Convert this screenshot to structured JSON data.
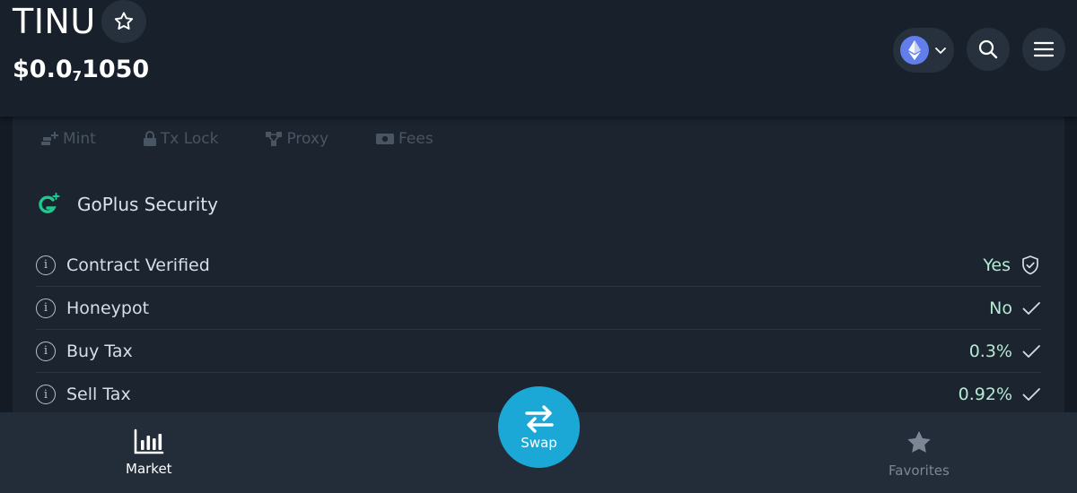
{
  "header": {
    "token_name": "TINU",
    "price_prefix": "$0.0",
    "price_zeros": "7",
    "price_suffix": "1050"
  },
  "tabs": [
    {
      "label": "Mint",
      "icon": "mint-icon"
    },
    {
      "label": "Tx Lock",
      "icon": "lock-icon"
    },
    {
      "label": "Proxy",
      "icon": "proxy-icon"
    },
    {
      "label": "Fees",
      "icon": "fees-icon"
    }
  ],
  "security": {
    "title": "GoPlus Security",
    "rows": [
      {
        "label": "Contract Verified",
        "value": "Yes",
        "icon": "shield-check-icon"
      },
      {
        "label": "Honeypot",
        "value": "No",
        "icon": "check-icon"
      },
      {
        "label": "Buy Tax",
        "value": "0.3%",
        "icon": "check-icon"
      },
      {
        "label": "Sell Tax",
        "value": "0.92%",
        "icon": "check-icon"
      }
    ]
  },
  "nav": {
    "market": "Market",
    "swap": "Swap",
    "favorites": "Favorites"
  },
  "colors": {
    "accent": "#1ba8d6",
    "positive": "#b5ead2",
    "goplus_green": "#1fc98e",
    "eth_blue": "#627eea"
  }
}
